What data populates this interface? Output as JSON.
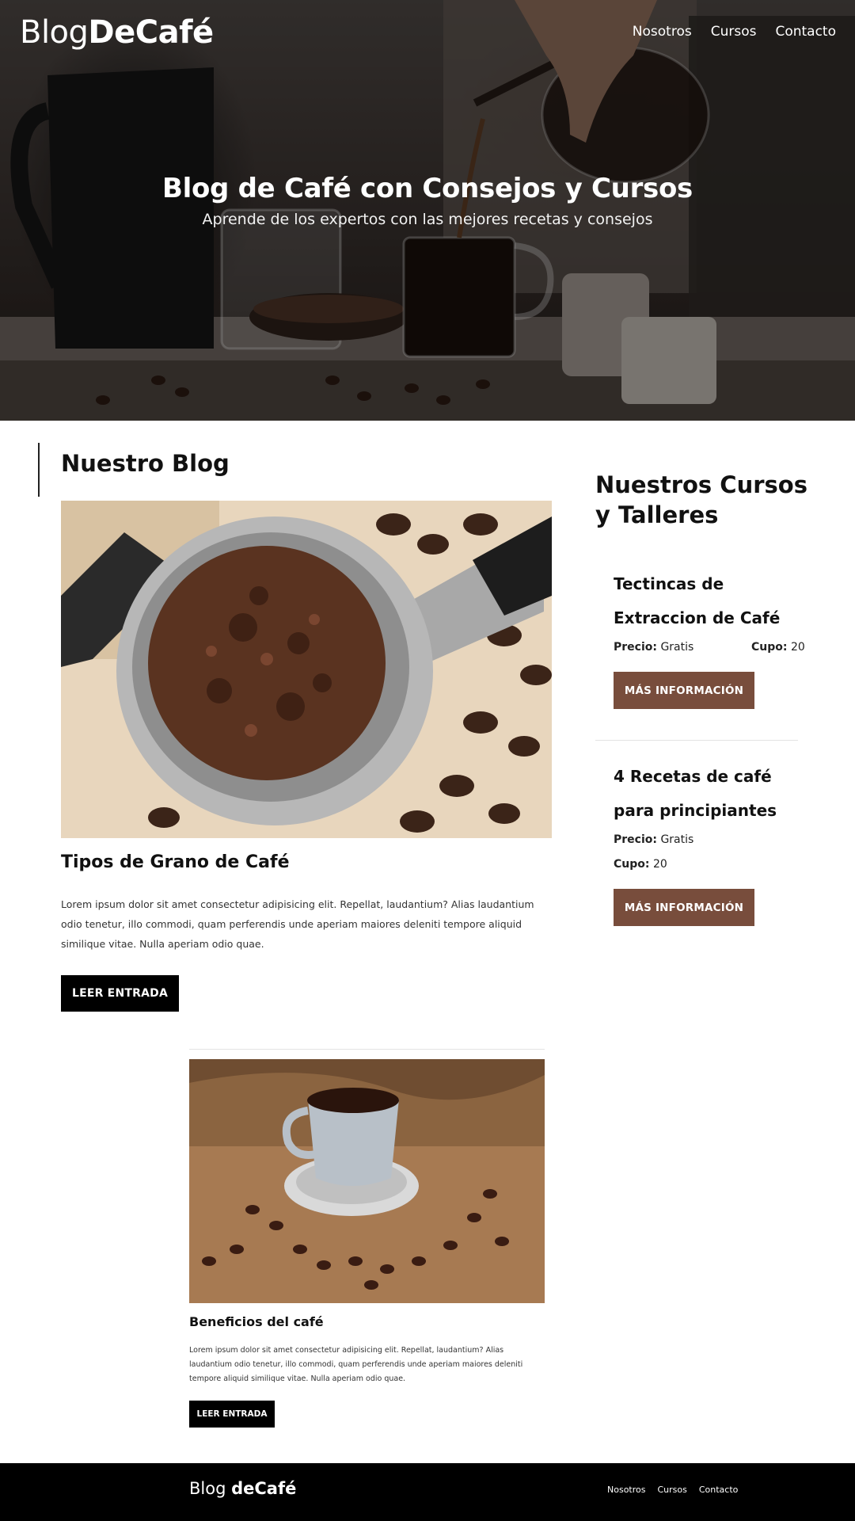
{
  "header": {
    "logo_light": "Blog",
    "logo_bold": "DeCafé",
    "nav": [
      {
        "label": "Nosotros"
      },
      {
        "label": "Cursos"
      },
      {
        "label": "Contacto"
      }
    ]
  },
  "hero": {
    "title": "Blog de Café con Consejos y Cursos",
    "subtitle": "Aprende de los expertos con las mejores recetas y consejos"
  },
  "blog": {
    "heading": "Nuestro Blog",
    "posts": [
      {
        "title": "Tipos de Grano de Café",
        "text": "Lorem ipsum dolor sit amet consectetur adipisicing elit. Repellat, laudantium? Alias laudantium odio tenetur, illo commodi, quam perferendis unde aperiam maiores deleniti tempore aliquid similique vitae. Nulla aperiam odio quae.",
        "button": "LEER ENTRADA",
        "image": "espresso-portafilter-photo"
      },
      {
        "title": "Beneficios del café",
        "text": "Lorem ipsum dolor sit amet consectetur adipisicing elit. Repellat, laudantium? Alias laudantium odio tenetur, illo commodi, quam perferendis unde aperiam maiores deleniti tempore aliquid similique vitae. Nulla aperiam odio quae.",
        "button": "LEER ENTRADA",
        "image": "coffee-cup-beans-photo"
      }
    ]
  },
  "courses": {
    "heading": "Nuestros Cursos y Talleres",
    "items": [
      {
        "title": "Tectincas de Extraccion de Café",
        "price_label": "Precio:",
        "price_value": "Gratis",
        "quota_label": "Cupo:",
        "quota_value": "20",
        "button": "MÁS INFORMACIÓN"
      },
      {
        "title": "4 Recetas de café para principiantes",
        "price_label": "Precio:",
        "price_value": "Gratis",
        "quota_label": "Cupo:",
        "quota_value": "20",
        "button": "MÁS INFORMACIÓN"
      }
    ]
  },
  "footer": {
    "logo_light": "Blog ",
    "logo_bold": "deCafé",
    "nav": [
      {
        "label": "Nosotros"
      },
      {
        "label": "Cursos"
      },
      {
        "label": "Contacto"
      }
    ]
  },
  "colors": {
    "accent_button": "#784d3c",
    "dark_button": "#000000",
    "footer_bg": "#000000"
  }
}
